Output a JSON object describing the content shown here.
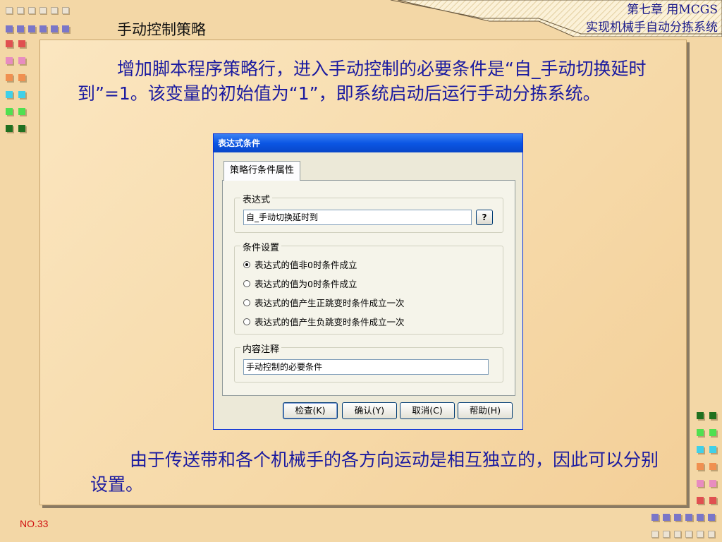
{
  "slide": {
    "section_title": "手动控制策略",
    "chapter_line1": "第七章 用MCGS",
    "chapter_line2": "实现机械手自动分拣系统",
    "page_number": "NO.33"
  },
  "paragraphs": {
    "p1": "增加脚本程序策略行，进入手动控制的必要条件是“自_手动切换延时到”=1。该变量的初始值为“1”，即系统启动后运行手动分拣系统。",
    "p2": "由于传送带和各个机械手的各方向运动是相互独立的，因此可以分别设置。"
  },
  "dialog": {
    "title": "表达式条件",
    "tab_label": "策略行条件属性",
    "expression_legend": "表达式",
    "expression_value": "自_手动切换延时到",
    "help_q": "?",
    "condition_legend": "条件设置",
    "options": [
      "表达式的值非0时条件成立",
      "表达式的值为0时条件成立",
      "表达式的值产生正跳变时条件成立一次",
      "表达式的值产生负跳变时条件成立一次"
    ],
    "selected_option_index": 0,
    "comment_legend": "内容注释",
    "comment_value": "手动控制的必要条件",
    "buttons": {
      "check": "检查(K)",
      "ok": "确认(Y)",
      "cancel": "取消(C)",
      "help": "帮助(H)"
    }
  },
  "colors": {
    "background": "#f3d7a6",
    "text_blue": "#1a1aa0",
    "page_number_red": "#d01010",
    "titlebar_blue": "#0b56e4"
  }
}
